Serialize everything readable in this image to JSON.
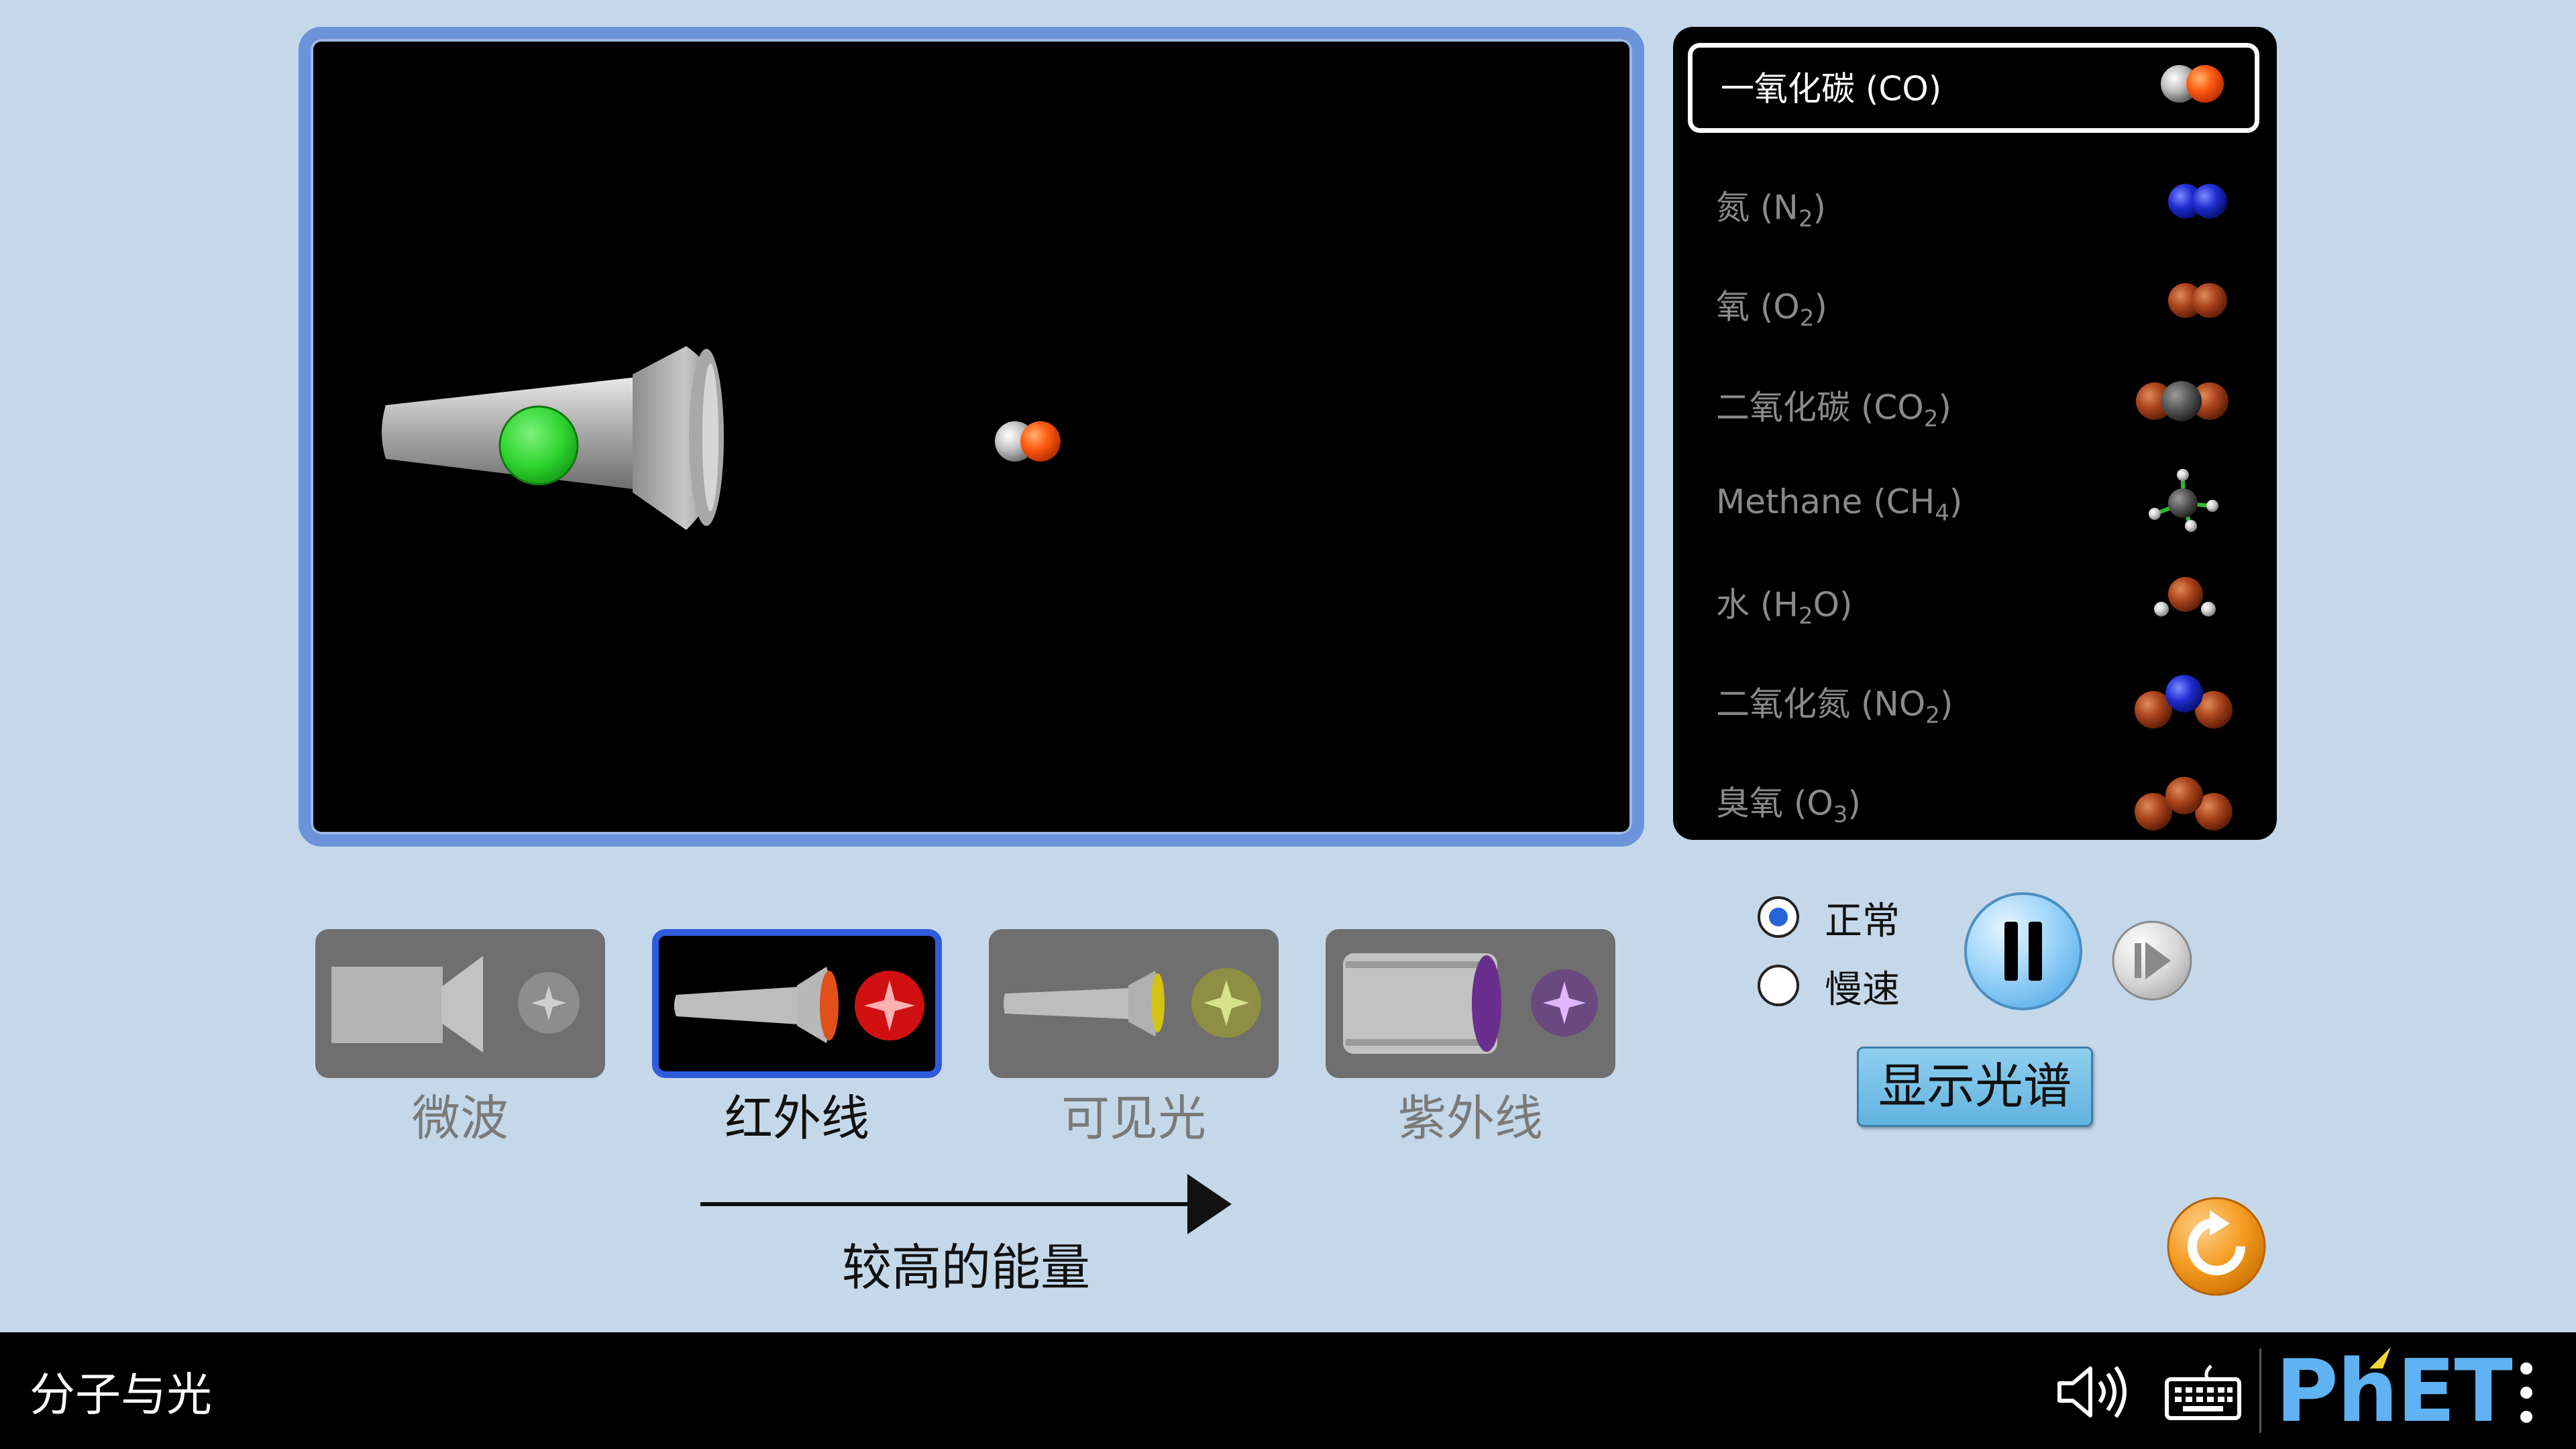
{
  "molecules": [
    {
      "name": "一氧化碳 ",
      "formula": "CO",
      "sub": "",
      "tail": "",
      "selected": true
    },
    {
      "name": "氮 ",
      "formula": "N",
      "sub": "2",
      "tail": "",
      "selected": false
    },
    {
      "name": "氧 ",
      "formula": "O",
      "sub": "2",
      "tail": "",
      "selected": false
    },
    {
      "name": "二氧化碳 ",
      "formula": "CO",
      "sub": "2",
      "tail": "",
      "selected": false
    },
    {
      "name": "Methane ",
      "formula": "CH",
      "sub": "4",
      "tail": "",
      "selected": false
    },
    {
      "name": "水 ",
      "formula": "H",
      "sub": "2",
      "tail": "O",
      "selected": false
    },
    {
      "name": "二氧化氮 ",
      "formula": "NO",
      "sub": "2",
      "tail": "",
      "selected": false
    },
    {
      "name": "臭氧 ",
      "formula": "O",
      "sub": "3",
      "tail": "",
      "selected": false
    }
  ],
  "light_sources": [
    {
      "label": "微波",
      "selected": false
    },
    {
      "label": "红外线",
      "selected": true
    },
    {
      "label": "可见光",
      "selected": false
    },
    {
      "label": "紫外线",
      "selected": false
    }
  ],
  "energy_arrow_label": "较高的能量",
  "speed": {
    "normal": "正常",
    "slow": "慢速",
    "selected": "normal"
  },
  "spectrum_button": "显示光谱",
  "sim_title": "分子与光",
  "brand": "PhET",
  "colors": {
    "background": "#c5d8ea",
    "frame": "#6a93da",
    "emitter_on": "#2fd42f",
    "selected_border": "#2f5bdc",
    "reset": "#f39a1f"
  },
  "icons": [
    "sound-icon",
    "keyboard-icon",
    "menu-dots-icon",
    "pause-icon",
    "step-forward-icon",
    "reset-icon"
  ]
}
